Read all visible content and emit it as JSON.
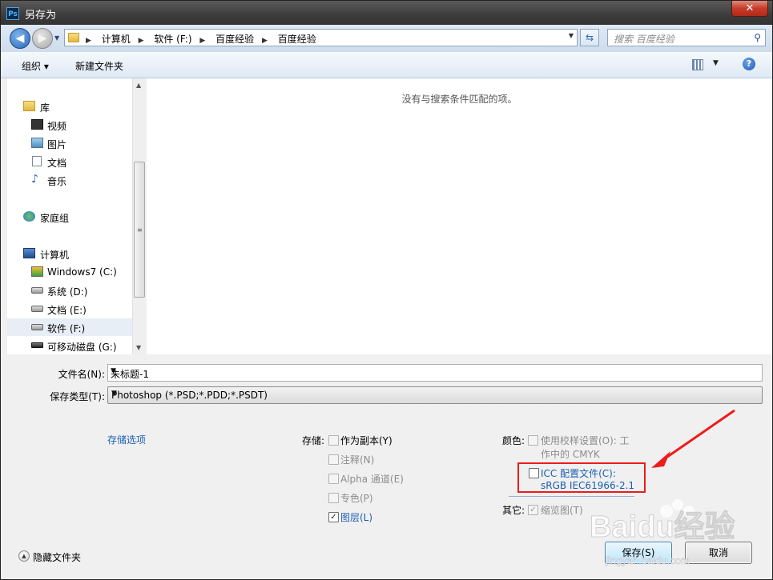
{
  "window": {
    "title": "另存为",
    "app_icon": "Ps",
    "close_label": "✕"
  },
  "breadcrumbs": [
    "计算机",
    "软件 (F:)",
    "百度经验",
    "百度经验"
  ],
  "search": {
    "placeholder": "搜索 百度经验"
  },
  "toolbar": {
    "organize": "组织 ▾",
    "new_folder": "新建文件夹"
  },
  "nav": {
    "items": [
      {
        "label": "库",
        "icon": "library-icon"
      },
      {
        "label": "视频",
        "icon": "video-icon"
      },
      {
        "label": "图片",
        "icon": "picture-icon"
      },
      {
        "label": "文档",
        "icon": "document-icon"
      },
      {
        "label": "音乐",
        "icon": "music-icon"
      },
      {
        "label": "家庭组",
        "icon": "homegroup-icon"
      },
      {
        "label": "计算机",
        "icon": "computer-icon"
      },
      {
        "label": "Windows7 (C:)",
        "icon": "system-drive-icon"
      },
      {
        "label": "系统 (D:)",
        "icon": "drive-icon"
      },
      {
        "label": "文档 (E:)",
        "icon": "drive-icon"
      },
      {
        "label": "软件 (F:)",
        "icon": "drive-icon"
      },
      {
        "label": "可移动磁盘 (G:)",
        "icon": "removable-drive-icon"
      }
    ]
  },
  "filelist": {
    "empty_message": "没有与搜索条件匹配的项。"
  },
  "form": {
    "filename_label": "文件名(N):",
    "filename_value": "未标题-1",
    "filetype_label": "保存类型(T):",
    "filetype_value": "Photoshop (*.PSD;*.PDD;*.PSDT)"
  },
  "options": {
    "storage_link": "存储选项",
    "save_label": "存储:",
    "as_copy": "作为副本(Y)",
    "notes": "注释(N)",
    "alpha": "Alpha 通道(E)",
    "spot": "专色(P)",
    "layers": "图层(L)",
    "color_label": "颜色:",
    "use_proof_1": "使用校样设置(O):  工",
    "use_proof_2": "作中的 CMYK",
    "icc_1": "ICC 配置文件(C):",
    "icc_2": "sRGB IEC61966-2.1",
    "other_label": "其它:",
    "thumbnail": "缩览图(T)"
  },
  "footer": {
    "hide_folders": "隐藏文件夹",
    "save_button": "保存(S)",
    "cancel_button": "取消"
  },
  "watermark": {
    "text": "Baidu经验",
    "url": "jingyan.baidu.com"
  },
  "colors": {
    "accent": "#1a5fb4",
    "highlight": "#ee1b1b"
  }
}
